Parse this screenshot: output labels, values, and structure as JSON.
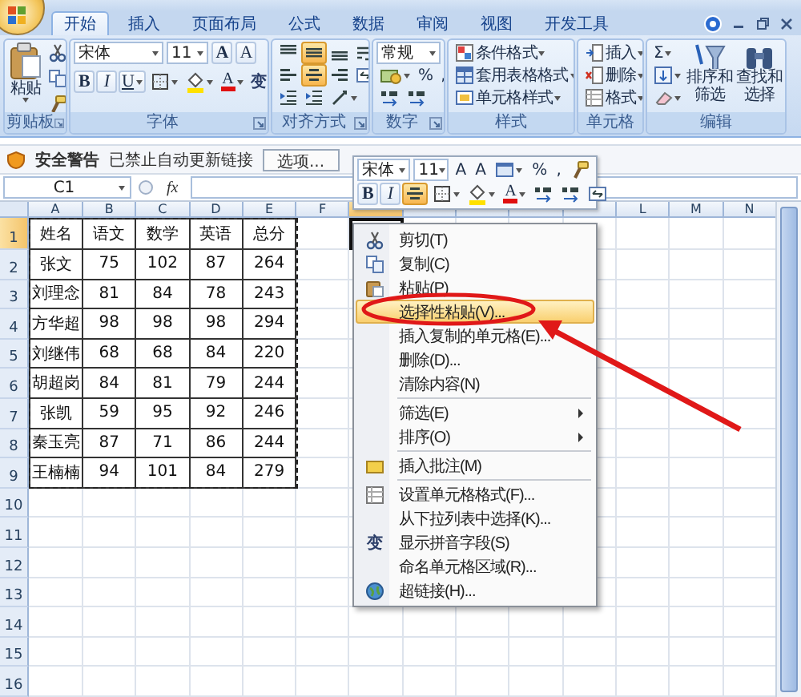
{
  "tabs": [
    {
      "label": "开始",
      "selected": true
    },
    {
      "label": "插入",
      "selected": false
    },
    {
      "label": "页面布局",
      "selected": false
    },
    {
      "label": "公式",
      "selected": false
    },
    {
      "label": "数据",
      "selected": false
    },
    {
      "label": "审阅",
      "selected": false
    },
    {
      "label": "视图",
      "selected": false
    },
    {
      "label": "开发工具",
      "selected": false
    }
  ],
  "ribbon": {
    "clipboard": {
      "label": "剪贴板",
      "paste": "粘贴"
    },
    "font": {
      "label": "字体",
      "font_name": "宋体",
      "font_size": "11",
      "grow": "A",
      "shrink": "A",
      "bold": "B",
      "italic": "I",
      "underline": "U",
      "font_color": "A",
      "phonetic": "变"
    },
    "alignment": {
      "label": "对齐方式",
      "vertical": [
        {
          "selected": false
        },
        {
          "selected": true
        },
        {
          "selected": false
        }
      ],
      "horizontal": [
        {
          "selected": false
        },
        {
          "selected": true
        },
        {
          "selected": false
        }
      ]
    },
    "number": {
      "label": "数字",
      "format": "常规",
      "percent": "%",
      "comma": ","
    },
    "styles": {
      "label": "样式",
      "items": [
        "条件格式",
        "套用表格格式",
        "单元格样式"
      ]
    },
    "cells": {
      "label": "单元格",
      "items": [
        "插入",
        "删除",
        "格式"
      ]
    },
    "editing": {
      "label": "编辑",
      "sum": "Σ",
      "sort_filter": "排序和筛选",
      "find_select": "查找和选择"
    }
  },
  "security_bar": {
    "title": "安全警告",
    "message": "已禁止自动更新链接",
    "button": "选项..."
  },
  "formula_bar": {
    "name_box": "C1",
    "function_label": "fx"
  },
  "sheet": {
    "columns": [
      {
        "label": "A",
        "selected": false
      },
      {
        "label": "B",
        "selected": false
      },
      {
        "label": "C",
        "selected": false
      },
      {
        "label": "D",
        "selected": false
      },
      {
        "label": "E",
        "selected": false
      },
      {
        "label": "F",
        "selected": false
      },
      {
        "selected": true
      },
      {
        "selected": false
      },
      {
        "selected": false
      },
      {
        "selected": false
      },
      {
        "selected": false
      },
      {
        "label": "L",
        "selected": false
      },
      {
        "label": "M",
        "selected": false
      },
      {
        "label": "N",
        "selected": false
      }
    ],
    "rows": [
      {
        "label": "1",
        "selected": true,
        "cells": [
          "姓名",
          "语文",
          "数学",
          "英语",
          "总分"
        ]
      },
      {
        "label": "2",
        "selected": false,
        "cells": [
          "张文",
          "75",
          "102",
          "87",
          "264"
        ]
      },
      {
        "label": "3",
        "selected": false,
        "cells": [
          "刘理念",
          "81",
          "84",
          "78",
          "243"
        ]
      },
      {
        "label": "4",
        "selected": false,
        "cells": [
          "方华超",
          "98",
          "98",
          "98",
          "294"
        ]
      },
      {
        "label": "5",
        "selected": false,
        "cells": [
          "刘继伟",
          "68",
          "68",
          "84",
          "220"
        ]
      },
      {
        "label": "6",
        "selected": false,
        "cells": [
          "胡超岗",
          "84",
          "81",
          "79",
          "244"
        ]
      },
      {
        "label": "7",
        "selected": false,
        "cells": [
          "张凯",
          "59",
          "95",
          "92",
          "246"
        ]
      },
      {
        "label": "8",
        "selected": false,
        "cells": [
          "秦玉亮",
          "87",
          "71",
          "86",
          "244"
        ]
      },
      {
        "label": "9",
        "selected": false,
        "cells": [
          "王楠楠",
          "94",
          "101",
          "84",
          "279"
        ]
      },
      {
        "label": "10",
        "selected": false
      },
      {
        "label": "11",
        "selected": false
      },
      {
        "label": "12",
        "selected": false
      },
      {
        "label": "13",
        "selected": false
      },
      {
        "label": "14",
        "selected": false
      },
      {
        "label": "15",
        "selected": false
      },
      {
        "label": "16",
        "selected": false
      }
    ]
  },
  "mini_toolbar": {
    "font_name": "宋体",
    "font_size": "11",
    "grow": "A",
    "shrink": "A",
    "percent": "%",
    "comma": ",",
    "bold": "B",
    "italic": "I",
    "font_color": "A",
    "center": {
      "selected": true
    }
  },
  "context_menu": {
    "sections": [
      [
        {
          "label": "剪切(T)",
          "selected": false,
          "submenu": false
        },
        {
          "label": "复制(C)",
          "selected": false,
          "submenu": false
        },
        {
          "label": "粘贴(P)",
          "selected": false,
          "submenu": false
        },
        {
          "label": "选择性粘贴(V)...",
          "selected": true,
          "submenu": false
        },
        {
          "label": "插入复制的单元格(E)...",
          "selected": false,
          "submenu": false
        },
        {
          "label": "删除(D)...",
          "selected": false,
          "submenu": false
        },
        {
          "label": "清除内容(N)",
          "selected": false,
          "submenu": false
        }
      ],
      [
        {
          "label": "筛选(E)",
          "selected": false,
          "submenu": true
        },
        {
          "label": "排序(O)",
          "selected": false,
          "submenu": true
        }
      ],
      [
        {
          "label": "插入批注(M)",
          "selected": false,
          "submenu": false
        }
      ],
      [
        {
          "label": "设置单元格格式(F)...",
          "selected": false,
          "submenu": false
        },
        {
          "label": "从下拉列表中选择(K)...",
          "selected": false,
          "submenu": false
        },
        {
          "label": "显示拼音字段(S)",
          "selected": false,
          "submenu": false,
          "icon_glyph": "变"
        },
        {
          "label": "命名单元格区域(R)...",
          "selected": false,
          "submenu": false
        },
        {
          "label": "超链接(H)...",
          "selected": false,
          "submenu": false
        }
      ]
    ]
  }
}
